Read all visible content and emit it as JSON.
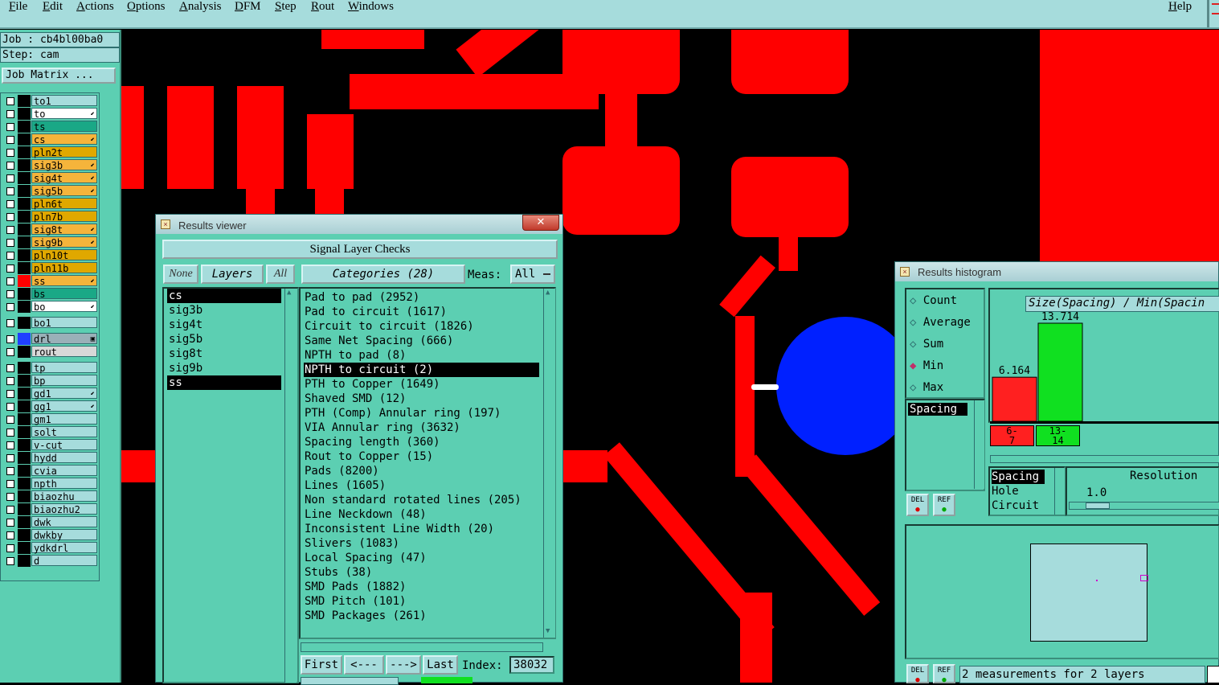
{
  "menu": {
    "items": [
      "File",
      "Edit",
      "Actions",
      "Options",
      "Analysis",
      "DFM",
      "Step",
      "Rout",
      "Windows"
    ],
    "help": "Help"
  },
  "left_panel": {
    "job": "Job : cb4bl00ba0",
    "step": "Step: cam",
    "job_matrix": "Job Matrix ..."
  },
  "layers": [
    {
      "name": "to1",
      "bg": "#a6dcdc",
      "mark": ""
    },
    {
      "name": "to",
      "bg": "#ffffff",
      "mark": "⬋"
    },
    {
      "name": "ts",
      "bg": "#1aa886",
      "mark": ""
    },
    {
      "name": "cs",
      "bg": "#f5b43b",
      "mark": "⬋"
    },
    {
      "name": "pln2t",
      "bg": "#e0a800",
      "mark": ""
    },
    {
      "name": "sig3b",
      "bg": "#f5b43b",
      "mark": "⬋"
    },
    {
      "name": "sig4t",
      "bg": "#f5b43b",
      "mark": "⬋"
    },
    {
      "name": "sig5b",
      "bg": "#f5b43b",
      "mark": "⬋"
    },
    {
      "name": "pln6t",
      "bg": "#e0a800",
      "mark": ""
    },
    {
      "name": "pln7b",
      "bg": "#e0a800",
      "mark": ""
    },
    {
      "name": "sig8t",
      "bg": "#f5b43b",
      "mark": "⬋"
    },
    {
      "name": "sig9b",
      "bg": "#f5b43b",
      "mark": "⬋"
    },
    {
      "name": "pln10t",
      "bg": "#e0a800",
      "mark": ""
    },
    {
      "name": "pln11b",
      "bg": "#e0a800",
      "mark": ""
    },
    {
      "name": "ss",
      "bg": "#f5b43b",
      "mark": "⬋"
    },
    {
      "name": "bs",
      "bg": "#1aa886",
      "mark": ""
    },
    {
      "name": "bo",
      "bg": "#ffffff",
      "mark": "⬋"
    },
    {
      "name": "bo1",
      "bg": "#a6dcdc",
      "mark": ""
    },
    {
      "name": "drl",
      "bg": "#9ab0b8",
      "mark": "▣"
    },
    {
      "name": "rout",
      "bg": "#d8d8d8",
      "mark": ""
    },
    {
      "name": "tp",
      "bg": "#a6dcdc",
      "mark": ""
    },
    {
      "name": "bp",
      "bg": "#a6dcdc",
      "mark": ""
    },
    {
      "name": "gd1",
      "bg": "#a6dcdc",
      "mark": "⬋"
    },
    {
      "name": "gg1",
      "bg": "#a6dcdc",
      "mark": "⬋"
    },
    {
      "name": "gm1",
      "bg": "#a6dcdc",
      "mark": ""
    },
    {
      "name": "solt",
      "bg": "#a6dcdc",
      "mark": ""
    },
    {
      "name": "v-cut",
      "bg": "#a6dcdc",
      "mark": ""
    },
    {
      "name": "hydd",
      "bg": "#a6dcdc",
      "mark": ""
    },
    {
      "name": "cvia",
      "bg": "#a6dcdc",
      "mark": ""
    },
    {
      "name": "npth",
      "bg": "#a6dcdc",
      "mark": ""
    },
    {
      "name": "biaozhu",
      "bg": "#a6dcdc",
      "mark": ""
    },
    {
      "name": "biaozhu2",
      "bg": "#a6dcdc",
      "mark": ""
    },
    {
      "name": "dwk",
      "bg": "#a6dcdc",
      "mark": ""
    },
    {
      "name": "dwkby",
      "bg": "#a6dcdc",
      "mark": ""
    },
    {
      "name": "ydkdrl",
      "bg": "#a6dcdc",
      "mark": ""
    },
    {
      "name": "d",
      "bg": "#a6dcdc",
      "mark": ""
    }
  ],
  "results_viewer": {
    "title": "Results viewer",
    "close": "✕",
    "header": "Signal Layer Checks",
    "none_btn": "None",
    "layers_btn": "Layers",
    "all_btn": "All",
    "categories_btn": "Categories (28)",
    "meas_label": "Meas:",
    "meas_value": "All",
    "layer_items": [
      "cs",
      "sig3b",
      "sig4t",
      "sig5b",
      "sig8t",
      "sig9b",
      "ss"
    ],
    "categories": [
      "Pad to pad (2952)",
      "Pad to circuit (1617)",
      "Circuit to circuit (1826)",
      "Same Net Spacing (666)",
      "NPTH to pad (8)",
      "NPTH to circuit (2)",
      "PTH to Copper (1649)",
      "Shaved SMD (12)",
      "PTH (Comp) Annular ring (197)",
      "VIA Annular ring (3632)",
      "Spacing length (360)",
      "Rout to Copper (15)",
      "Pads (8200)",
      "Lines (1605)",
      "Non standard rotated lines (205)",
      "Line Neckdown (48)",
      "Inconsistent Line Width (20)",
      "Slivers (1083)",
      "Local Spacing (47)",
      "Stubs (38)",
      "SMD Pads (1882)",
      "SMD Pitch (101)",
      "SMD Packages (261)"
    ],
    "selected_category": 5,
    "first_btn": "First",
    "prev_btn": "<---",
    "next_btn": "--->",
    "last_btn": "Last",
    "index_label": "Index:",
    "index_value": "38032"
  },
  "histogram": {
    "title": "Results histogram",
    "modes": [
      "Count",
      "Average",
      "Sum",
      "Min",
      "Max"
    ],
    "selected_mode": "Min",
    "chart_title": "Size(Spacing) / Min(Spacin",
    "bars": [
      {
        "label": "6.164",
        "value": 6.164,
        "bin": "6-\n7",
        "color": "#ff2020"
      },
      {
        "label": "13.714",
        "value": 13.714,
        "bin": "13-\n14",
        "color": "#10e020"
      }
    ],
    "measure_list": [
      "Spacing"
    ],
    "type_list": [
      "Spacing",
      "Hole",
      "Circuit"
    ],
    "resolution_label": "Resolution",
    "resolution_value": "1.0",
    "del_btn": "DEL",
    "ref_btn": "REF",
    "status": "2 measurements for 2 layers"
  }
}
